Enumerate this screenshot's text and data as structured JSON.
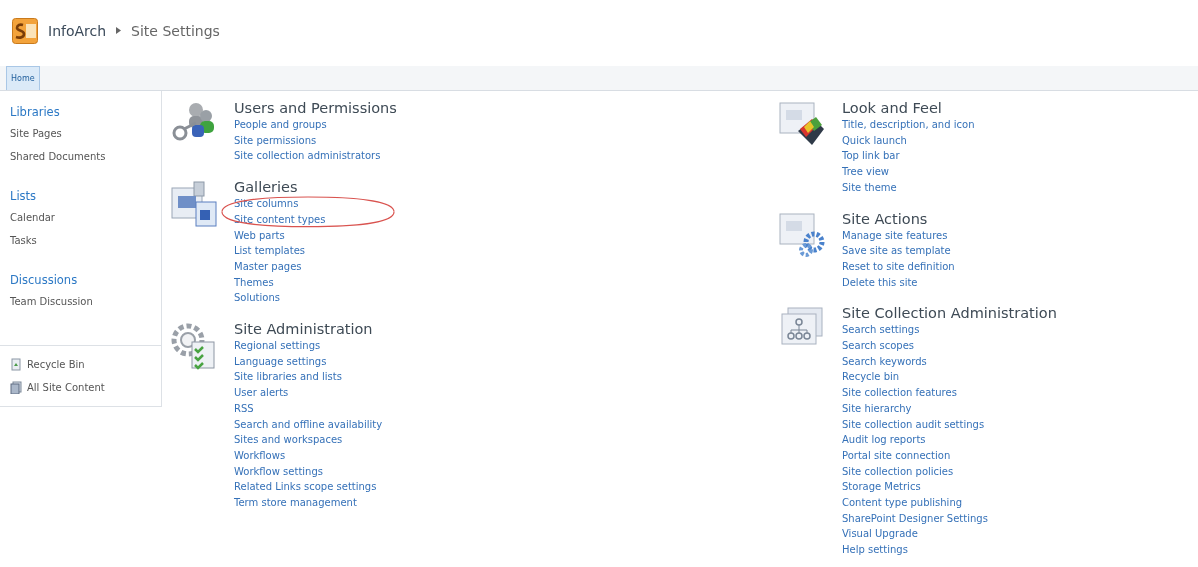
{
  "breadcrumb": {
    "site": "InfoArch",
    "page": "Site Settings"
  },
  "tabs": [
    {
      "label": "Home",
      "selected": true
    }
  ],
  "quick_launch": {
    "groups": [
      {
        "heading": "Libraries",
        "items": [
          "Site Pages",
          "Shared Documents"
        ]
      },
      {
        "heading": "Lists",
        "items": [
          "Calendar",
          "Tasks"
        ]
      },
      {
        "heading": "Discussions",
        "items": [
          "Team Discussion"
        ]
      }
    ],
    "footer_items": [
      {
        "label": "Recycle Bin",
        "kind": "recycle"
      },
      {
        "label": "All Site Content",
        "kind": "content"
      }
    ]
  },
  "columns": [
    [
      {
        "title": "Users and Permissions",
        "kind": "users",
        "links": [
          {
            "label": "People and groups",
            "circled": false
          },
          {
            "label": "Site permissions",
            "circled": false
          },
          {
            "label": "Site collection administrators",
            "circled": false
          }
        ]
      },
      {
        "title": "Galleries",
        "kind": "galleries",
        "links": [
          {
            "label": "Site columns",
            "circled": true
          },
          {
            "label": "Site content types",
            "circled": true
          },
          {
            "label": "Web parts",
            "circled": false
          },
          {
            "label": "List templates",
            "circled": false
          },
          {
            "label": "Master pages",
            "circled": false
          },
          {
            "label": "Themes",
            "circled": false
          },
          {
            "label": "Solutions",
            "circled": false
          }
        ]
      },
      {
        "title": "Site Administration",
        "kind": "admin",
        "links": [
          {
            "label": "Regional settings",
            "circled": false
          },
          {
            "label": "Language settings",
            "circled": false
          },
          {
            "label": "Site libraries and lists",
            "circled": false
          },
          {
            "label": "User alerts",
            "circled": false
          },
          {
            "label": "RSS",
            "circled": false
          },
          {
            "label": "Search and offline availability",
            "circled": false
          },
          {
            "label": "Sites and workspaces",
            "circled": false
          },
          {
            "label": "Workflows",
            "circled": false
          },
          {
            "label": "Workflow settings",
            "circled": false
          },
          {
            "label": "Related Links scope settings",
            "circled": false
          },
          {
            "label": "Term store management",
            "circled": false
          }
        ]
      }
    ],
    [
      {
        "title": "Look and Feel",
        "kind": "look",
        "links": [
          {
            "label": "Title, description, and icon",
            "circled": false
          },
          {
            "label": "Quick launch",
            "circled": false
          },
          {
            "label": "Top link bar",
            "circled": false
          },
          {
            "label": "Tree view",
            "circled": false
          },
          {
            "label": "Site theme",
            "circled": false
          }
        ]
      },
      {
        "title": "Site Actions",
        "kind": "actions",
        "links": [
          {
            "label": "Manage site features",
            "circled": false
          },
          {
            "label": "Save site as template",
            "circled": false
          },
          {
            "label": "Reset to site definition",
            "circled": false
          },
          {
            "label": "Delete this site",
            "circled": false
          }
        ]
      },
      {
        "title": "Site Collection Administration",
        "kind": "collection",
        "links": [
          {
            "label": "Search settings",
            "circled": false
          },
          {
            "label": "Search scopes",
            "circled": false
          },
          {
            "label": "Search keywords",
            "circled": false
          },
          {
            "label": "Recycle bin",
            "circled": false
          },
          {
            "label": "Site collection features",
            "circled": false
          },
          {
            "label": "Site hierarchy",
            "circled": false
          },
          {
            "label": "Site collection audit settings",
            "circled": false
          },
          {
            "label": "Audit log reports",
            "circled": false
          },
          {
            "label": "Portal site connection",
            "circled": false
          },
          {
            "label": "Site collection policies",
            "circled": false
          },
          {
            "label": "Storage Metrics",
            "circled": false
          },
          {
            "label": "Content type publishing",
            "circled": false
          },
          {
            "label": "SharePoint Designer Settings",
            "circled": false
          },
          {
            "label": "Visual Upgrade",
            "circled": false
          },
          {
            "label": "Help settings",
            "circled": false
          }
        ]
      }
    ]
  ]
}
